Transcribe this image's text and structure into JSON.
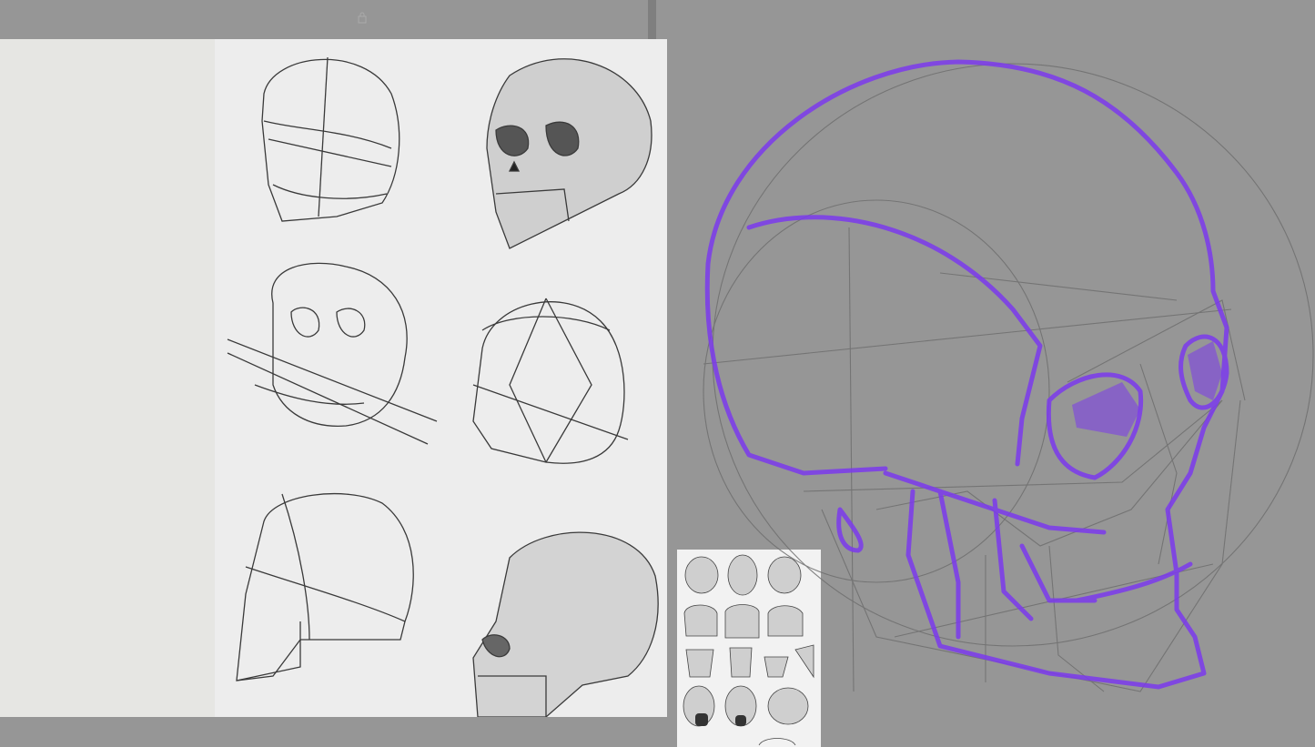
{
  "colors": {
    "canvas": "#969696",
    "reference_paper": "#ededed",
    "pencil": "#3a3a3a",
    "guide": "#7a7a7a",
    "brush": "#7c3aed"
  },
  "icons": {
    "panel_handle": "lock-icon"
  },
  "panels": {
    "reference_sheet": "skull-construction-reference",
    "thumbnail": "skull-planes-reference",
    "canvas": "skull-sketch-canvas"
  }
}
